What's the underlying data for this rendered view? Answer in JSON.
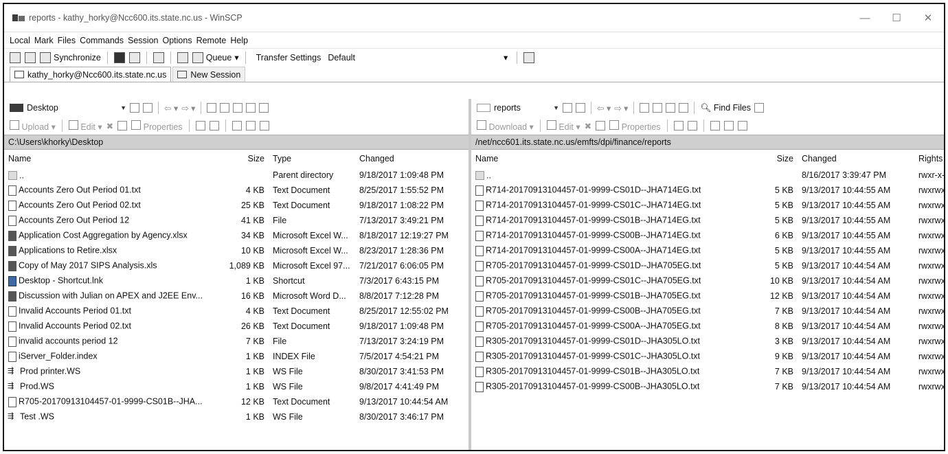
{
  "window": {
    "title": "reports - kathy_horky@Ncc600.its.state.nc.us - WinSCP",
    "controls": {
      "minimize": "—",
      "maximize": "☐",
      "close": "✕"
    }
  },
  "menu": [
    "Local",
    "Mark",
    "Files",
    "Commands",
    "Session",
    "Options",
    "Remote",
    "Help"
  ],
  "toolbar": {
    "synchronize": "Synchronize",
    "queue": "Queue",
    "queue_arrow": "▾",
    "transfer_settings_label": "Transfer Settings",
    "transfer_settings_value": "Default",
    "dropdown_arrow": "▾"
  },
  "tabs": [
    {
      "label": "kathy_horky@Ncc600.its.state.nc.us"
    },
    {
      "label": "New Session"
    }
  ],
  "local": {
    "location": "Desktop",
    "actions": {
      "upload": "Upload",
      "edit": "Edit",
      "properties": "Properties"
    },
    "path": "C:\\Users\\khorky\\Desktop",
    "columns": {
      "name": "Name",
      "size": "Size",
      "type": "Type",
      "changed": "Changed"
    },
    "files": [
      {
        "icon": "up",
        "name": "..",
        "size": "",
        "type": "Parent directory",
        "changed": "9/18/2017 1:09:48 PM"
      },
      {
        "icon": "txt",
        "name": "Accounts Zero Out Period 01.txt",
        "size": "4 KB",
        "type": "Text Document",
        "changed": "8/25/2017 1:55:52 PM"
      },
      {
        "icon": "txt",
        "name": "Accounts Zero Out Period 02.txt",
        "size": "25 KB",
        "type": "Text Document",
        "changed": "9/18/2017 1:08:22 PM"
      },
      {
        "icon": "file",
        "name": "Accounts Zero Out Period 12",
        "size": "41 KB",
        "type": "File",
        "changed": "7/13/2017 3:49:21 PM"
      },
      {
        "icon": "xl",
        "name": "Application Cost Aggregation by Agency.xlsx",
        "size": "34 KB",
        "type": "Microsoft Excel W...",
        "changed": "8/18/2017 12:19:27 PM"
      },
      {
        "icon": "xl",
        "name": "Applications to Retire.xlsx",
        "size": "10 KB",
        "type": "Microsoft Excel W...",
        "changed": "8/23/2017 1:28:36 PM"
      },
      {
        "icon": "xl",
        "name": "Copy of May 2017 SIPS Analysis.xls",
        "size": "1,089 KB",
        "type": "Microsoft Excel 97...",
        "changed": "7/21/2017 6:06:05 PM"
      },
      {
        "icon": "lnk",
        "name": "Desktop - Shortcut.lnk",
        "size": "1 KB",
        "type": "Shortcut",
        "changed": "7/3/2017 6:43:15 PM"
      },
      {
        "icon": "xl",
        "name": "Discussion with Julian on APEX and J2EE Env...",
        "size": "16 KB",
        "type": "Microsoft Word D...",
        "changed": "8/8/2017 7:12:28 PM"
      },
      {
        "icon": "txt",
        "name": "Invalid Accounts Period 01.txt",
        "size": "4 KB",
        "type": "Text Document",
        "changed": "8/25/2017 12:55:02 PM"
      },
      {
        "icon": "txt",
        "name": "Invalid Accounts Period 02.txt",
        "size": "26 KB",
        "type": "Text Document",
        "changed": "9/18/2017 1:09:48 PM"
      },
      {
        "icon": "file",
        "name": "invalid accounts period 12",
        "size": "7 KB",
        "type": "File",
        "changed": "7/13/2017 3:24:19 PM"
      },
      {
        "icon": "file",
        "name": "iServer_Folder.index",
        "size": "1 KB",
        "type": "INDEX File",
        "changed": "7/5/2017 4:54:21 PM"
      },
      {
        "icon": "ws",
        "name": "Prod printer.WS",
        "size": "1 KB",
        "type": "WS File",
        "changed": "8/30/2017 3:41:53 PM"
      },
      {
        "icon": "ws",
        "name": "Prod.WS",
        "size": "1 KB",
        "type": "WS File",
        "changed": "9/8/2017 4:41:49 PM"
      },
      {
        "icon": "txt",
        "name": "R705-20170913104457-01-9999-CS01B--JHA...",
        "size": "12 KB",
        "type": "Text Document",
        "changed": "9/13/2017 10:44:54 AM"
      },
      {
        "icon": "ws",
        "name": "Test .WS",
        "size": "1 KB",
        "type": "WS File",
        "changed": "8/30/2017 3:46:17 PM"
      }
    ]
  },
  "remote": {
    "location": "reports",
    "find_files": "Find Files",
    "actions": {
      "download": "Download",
      "edit": "Edit",
      "properties": "Properties"
    },
    "path": "/net/ncc601.its.state.nc.us/emfts/dpi/finance/reports",
    "columns": {
      "name": "Name",
      "size": "Size",
      "changed": "Changed",
      "rights": "Rights"
    },
    "files": [
      {
        "icon": "up",
        "name": "..",
        "size": "",
        "changed": "8/16/2017 3:39:47 PM",
        "rights": "rwxr-x-"
      },
      {
        "icon": "txt",
        "name": "R714-20170913104457-01-9999-CS01D--JHA714EG.txt",
        "size": "5 KB",
        "changed": "9/13/2017 10:44:55 AM",
        "rights": "rwxrwx"
      },
      {
        "icon": "txt",
        "name": "R714-20170913104457-01-9999-CS01C--JHA714EG.txt",
        "size": "5 KB",
        "changed": "9/13/2017 10:44:55 AM",
        "rights": "rwxrwx"
      },
      {
        "icon": "txt",
        "name": "R714-20170913104457-01-9999-CS01B--JHA714EG.txt",
        "size": "5 KB",
        "changed": "9/13/2017 10:44:55 AM",
        "rights": "rwxrwx"
      },
      {
        "icon": "txt",
        "name": "R714-20170913104457-01-9999-CS00B--JHA714EG.txt",
        "size": "6 KB",
        "changed": "9/13/2017 10:44:55 AM",
        "rights": "rwxrwx"
      },
      {
        "icon": "txt",
        "name": "R714-20170913104457-01-9999-CS00A--JHA714EG.txt",
        "size": "5 KB",
        "changed": "9/13/2017 10:44:55 AM",
        "rights": "rwxrwx"
      },
      {
        "icon": "txt",
        "name": "R705-20170913104457-01-9999-CS01D--JHA705EG.txt",
        "size": "5 KB",
        "changed": "9/13/2017 10:44:54 AM",
        "rights": "rwxrwx"
      },
      {
        "icon": "txt",
        "name": "R705-20170913104457-01-9999-CS01C--JHA705EG.txt",
        "size": "10 KB",
        "changed": "9/13/2017 10:44:54 AM",
        "rights": "rwxrwx"
      },
      {
        "icon": "txt",
        "name": "R705-20170913104457-01-9999-CS01B--JHA705EG.txt",
        "size": "12 KB",
        "changed": "9/13/2017 10:44:54 AM",
        "rights": "rwxrwx"
      },
      {
        "icon": "txt",
        "name": "R705-20170913104457-01-9999-CS00B--JHA705EG.txt",
        "size": "7 KB",
        "changed": "9/13/2017 10:44:54 AM",
        "rights": "rwxrwx"
      },
      {
        "icon": "txt",
        "name": "R705-20170913104457-01-9999-CS00A--JHA705EG.txt",
        "size": "8 KB",
        "changed": "9/13/2017 10:44:54 AM",
        "rights": "rwxrwx"
      },
      {
        "icon": "txt",
        "name": "R305-20170913104457-01-9999-CS01D--JHA305LO.txt",
        "size": "3 KB",
        "changed": "9/13/2017 10:44:54 AM",
        "rights": "rwxrwx"
      },
      {
        "icon": "txt",
        "name": "R305-20170913104457-01-9999-CS01C--JHA305LO.txt",
        "size": "9 KB",
        "changed": "9/13/2017 10:44:54 AM",
        "rights": "rwxrwx"
      },
      {
        "icon": "txt",
        "name": "R305-20170913104457-01-9999-CS01B--JHA305LO.txt",
        "size": "7 KB",
        "changed": "9/13/2017 10:44:54 AM",
        "rights": "rwxrwx"
      },
      {
        "icon": "txt",
        "name": "R305-20170913104457-01-9999-CS00B--JHA305LO.txt",
        "size": "7 KB",
        "changed": "9/13/2017 10:44:54 AM",
        "rights": "rwxrwx"
      }
    ]
  }
}
